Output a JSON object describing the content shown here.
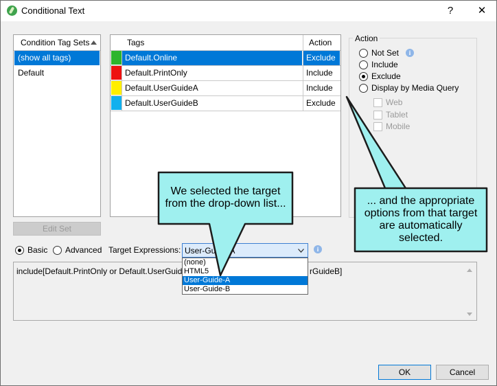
{
  "window": {
    "title": "Conditional Text",
    "help_glyph": "?",
    "close_glyph": "✕"
  },
  "tag_sets": {
    "header": "Condition Tag Sets",
    "items": [
      "(show all tags)",
      "Default"
    ],
    "edit_button": "Edit Set"
  },
  "tags": {
    "header_tags": "Tags",
    "header_action": "Action",
    "rows": [
      {
        "name": "Default.Online",
        "action": "Exclude",
        "color": "#2db52d"
      },
      {
        "name": "Default.PrintOnly",
        "action": "Include",
        "color": "#ee1111"
      },
      {
        "name": "Default.UserGuideA",
        "action": "Include",
        "color": "#ffee00"
      },
      {
        "name": "Default.UserGuideB",
        "action": "Exclude",
        "color": "#11b0ee"
      }
    ]
  },
  "action_group": {
    "title": "Action",
    "options": [
      "Not Set",
      "Include",
      "Exclude",
      "Display by Media Query"
    ],
    "selected": "Exclude",
    "media": [
      "Web",
      "Tablet",
      "Mobile"
    ]
  },
  "mode": {
    "basic": "Basic",
    "advanced": "Advanced",
    "target_label": "Target Expressions:",
    "target_value": "User-Guide-A"
  },
  "dropdown": {
    "options": [
      "(none)",
      "HTML5",
      "User-Guide-A",
      "User-Guide-B"
    ],
    "selected": "User-Guide-A"
  },
  "expression": {
    "left": "include[Default.PrintOnly or Default.UserGuideA] ,",
    "right": "rGuideB]"
  },
  "callouts": {
    "left": "We selected the target from the drop-down list...",
    "right": "... and the appropriate options from that target are automatically selected."
  },
  "buttons": {
    "ok": "OK",
    "cancel": "Cancel"
  },
  "colors": {
    "accent": "#0078d7",
    "callout_fill": "#9ff0ef",
    "callout_border": "#1c1c1c"
  }
}
